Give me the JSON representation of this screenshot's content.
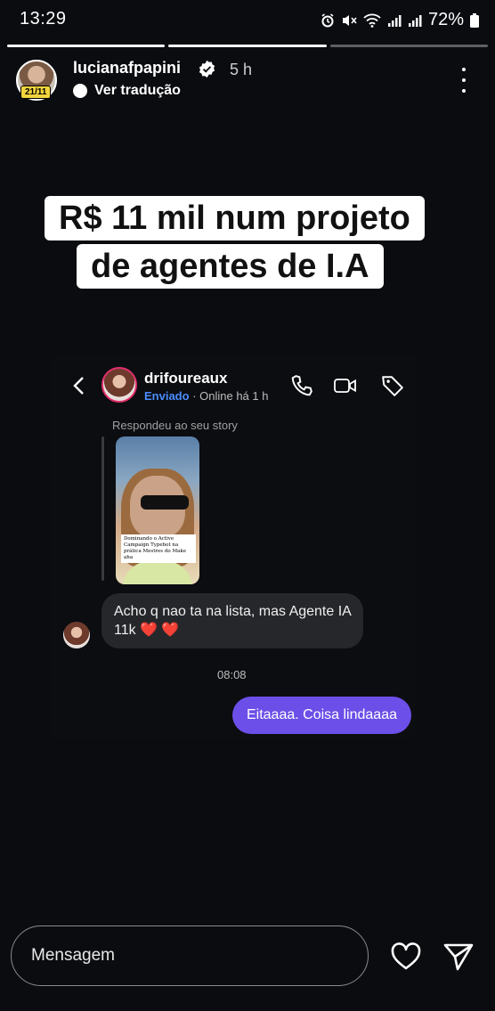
{
  "status_bar": {
    "time": "13:29",
    "battery": "72%"
  },
  "story_progress": [
    1.0,
    1.0,
    0.0
  ],
  "header": {
    "username": "lucianafpapini",
    "time_ago": "5 h",
    "avatar_badge": "21/11",
    "translate_label": "Ver tradução"
  },
  "story": {
    "title_line1": "R$ 11 mil num projeto",
    "title_line2": "de agentes de I.A",
    "dm": {
      "contact_name": "drifoureaux",
      "sent_label": "Enviado",
      "separator": " · ",
      "online_status": "Online há 1 h",
      "replied_label": "Respondeu ao seu story",
      "thumbnail_caption": "Dominando o Active Campaign Typebot na prática Mestres do Make aha",
      "received_message": "Acho q nao ta na lista, mas Agente IA 11k",
      "received_hearts": "❤️ ❤️",
      "timestamp": "08:08",
      "sent_message": "Eitaaaa. Coisa lindaaaa"
    }
  },
  "footer": {
    "message_placeholder": "Mensagem"
  },
  "colors": {
    "background": "#0b0c10",
    "sent_bubble": "#6c4fe8",
    "received_bubble": "#26272b",
    "verified": "#ffffff",
    "sent_label": "#4a8cff",
    "badge": "#f2d43d"
  }
}
